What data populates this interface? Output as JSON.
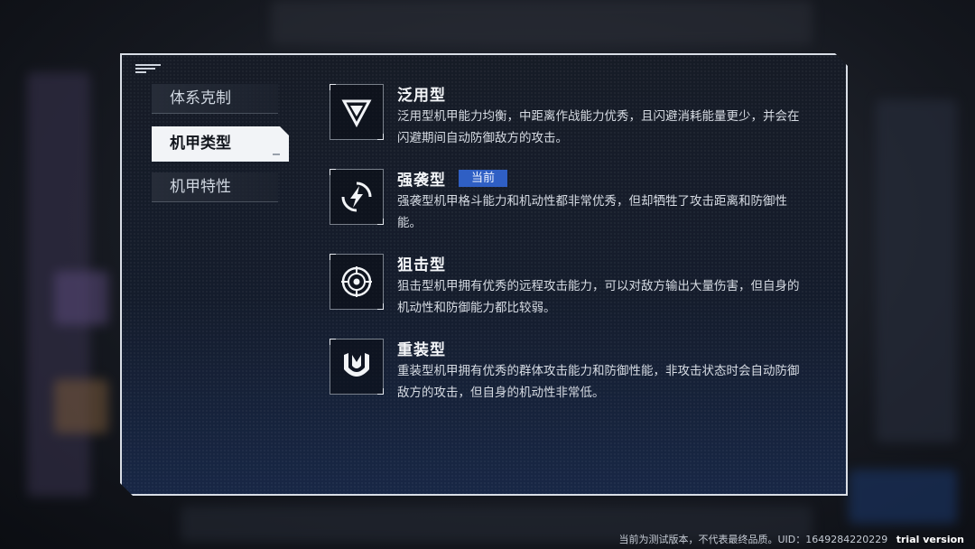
{
  "tabs": [
    {
      "label": "体系克制",
      "active": false
    },
    {
      "label": "机甲类型",
      "active": true
    },
    {
      "label": "机甲特性",
      "active": false
    }
  ],
  "types": [
    {
      "icon": "triangle-emblem-icon",
      "title": "泛用型",
      "badge": "",
      "desc": "泛用型机甲能力均衡，中距离作战能力优秀，且闪避消耗能量更少，并会在闪避期间自动防御敌方的攻击。"
    },
    {
      "icon": "lightning-circle-icon",
      "title": "强袭型",
      "badge": "当前",
      "desc": "强袭型机甲格斗能力和机动性都非常优秀，但却牺牲了攻击距离和防御性能。"
    },
    {
      "icon": "crosshair-icon",
      "title": "狙击型",
      "badge": "",
      "desc": "狙击型机甲拥有优秀的远程攻击能力，可以对敌方输出大量伤害，但自身的机动性和防御能力都比较弱。"
    },
    {
      "icon": "shield-icon",
      "title": "重装型",
      "badge": "",
      "desc": "重装型机甲拥有优秀的群体攻击能力和防御性能，非攻击状态时会自动防御敌方的攻击，但自身的机动性非常低。"
    }
  ],
  "footer": {
    "notice": "当前为测试版本，不代表最终品质。UID：1649284220229",
    "trial": "trial version"
  },
  "colors": {
    "badge": "#2f5fc4",
    "panel_border": "#d9dee6",
    "active_tab_bg": "#f2f4f7"
  }
}
